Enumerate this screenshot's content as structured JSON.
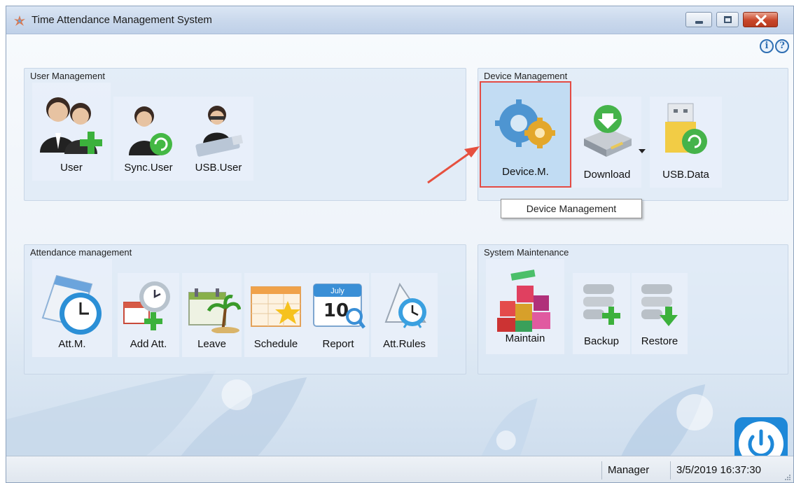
{
  "window": {
    "title": "Time Attendance Management System"
  },
  "help": {
    "info_glyph": "i",
    "help_glyph": "?"
  },
  "groups": {
    "user": {
      "title": "User Management",
      "items": [
        "User",
        "Sync.User",
        "USB.User"
      ]
    },
    "device": {
      "title": "Device Management",
      "items": [
        "Device.M.",
        "Download",
        "USB.Data"
      ]
    },
    "attendance": {
      "title": "Attendance management",
      "items": [
        "Att.M.",
        "Add Att.",
        "Leave",
        "Schedule",
        "Report",
        "Att.Rules"
      ]
    },
    "system": {
      "title": "System Maintenance",
      "items": [
        "Maintain",
        "Backup",
        "Restore"
      ]
    }
  },
  "report_icon": {
    "month": "July",
    "day": "10"
  },
  "tooltip": {
    "text": "Device Management"
  },
  "status": {
    "user": "Manager",
    "datetime": "3/5/2019 16:37:30"
  },
  "colors": {
    "accent": "#1e88d8",
    "highlight_border": "#e44b44",
    "arrow": "#e6503f"
  }
}
